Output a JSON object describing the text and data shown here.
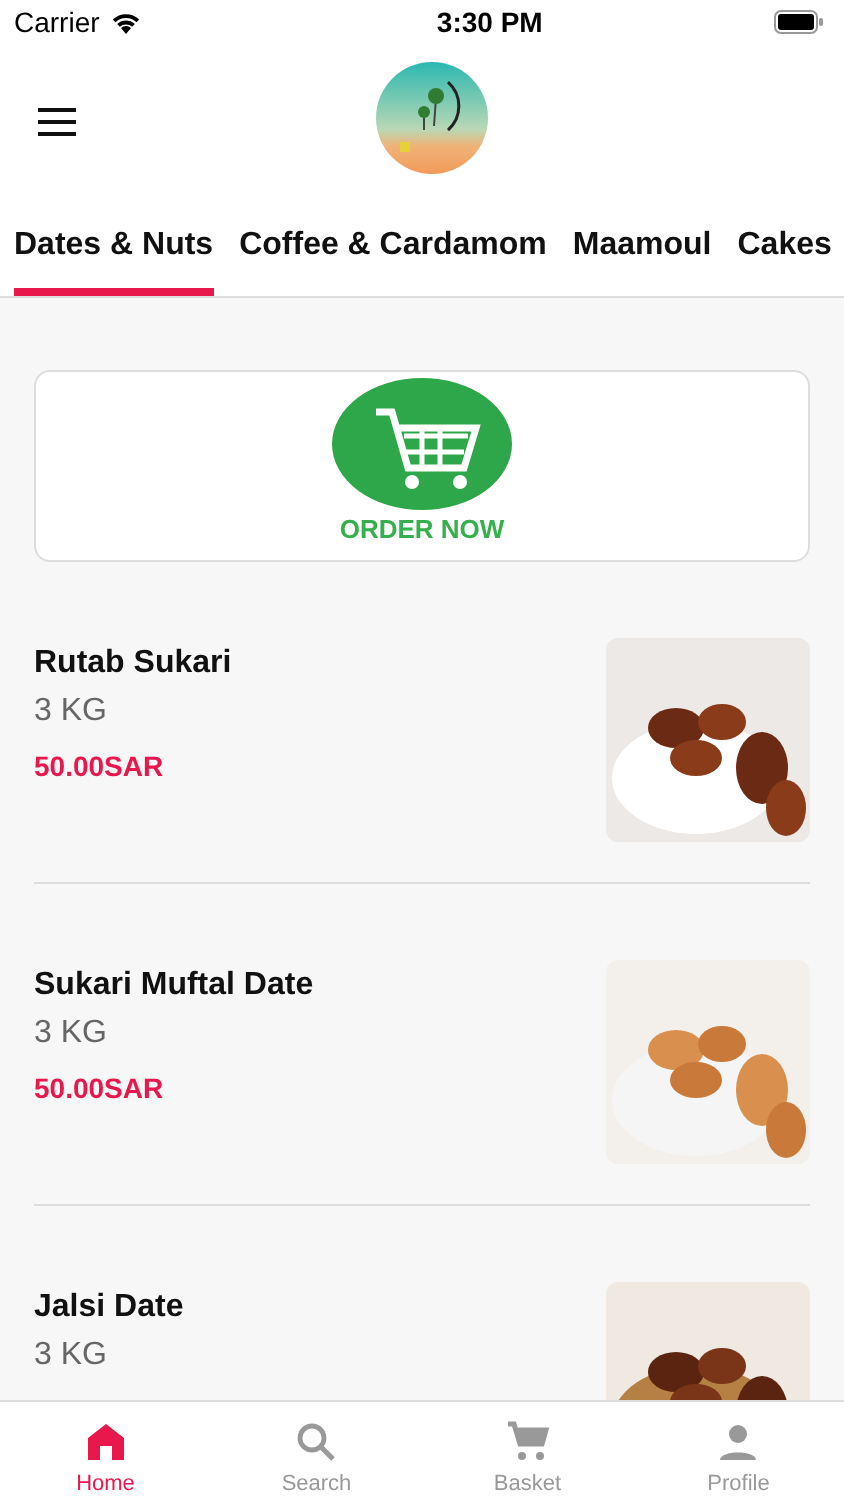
{
  "status_bar": {
    "carrier": "Carrier",
    "time": "3:30 PM"
  },
  "tabs": [
    {
      "label": "Dates & Nuts",
      "selected": true
    },
    {
      "label": "Coffee & Cardamom",
      "selected": false
    },
    {
      "label": "Maamoul",
      "selected": false
    },
    {
      "label": "Cakes",
      "selected": false
    }
  ],
  "banner": {
    "caption": "ORDER NOW"
  },
  "products": [
    {
      "name": "Rutab Sukari",
      "quantity": "3 KG",
      "price": "50.00SAR"
    },
    {
      "name": "Sukari Muftal Date",
      "quantity": "3 KG",
      "price": "50.00SAR"
    },
    {
      "name": "Jalsi Date",
      "quantity": "3 KG"
    }
  ],
  "bottom_nav": [
    {
      "label": "Home",
      "kind": "home",
      "selected": true
    },
    {
      "label": "Search",
      "kind": "search",
      "selected": false
    },
    {
      "label": "Basket",
      "kind": "cart",
      "selected": false
    },
    {
      "label": "Profile",
      "kind": "person",
      "selected": false
    }
  ]
}
